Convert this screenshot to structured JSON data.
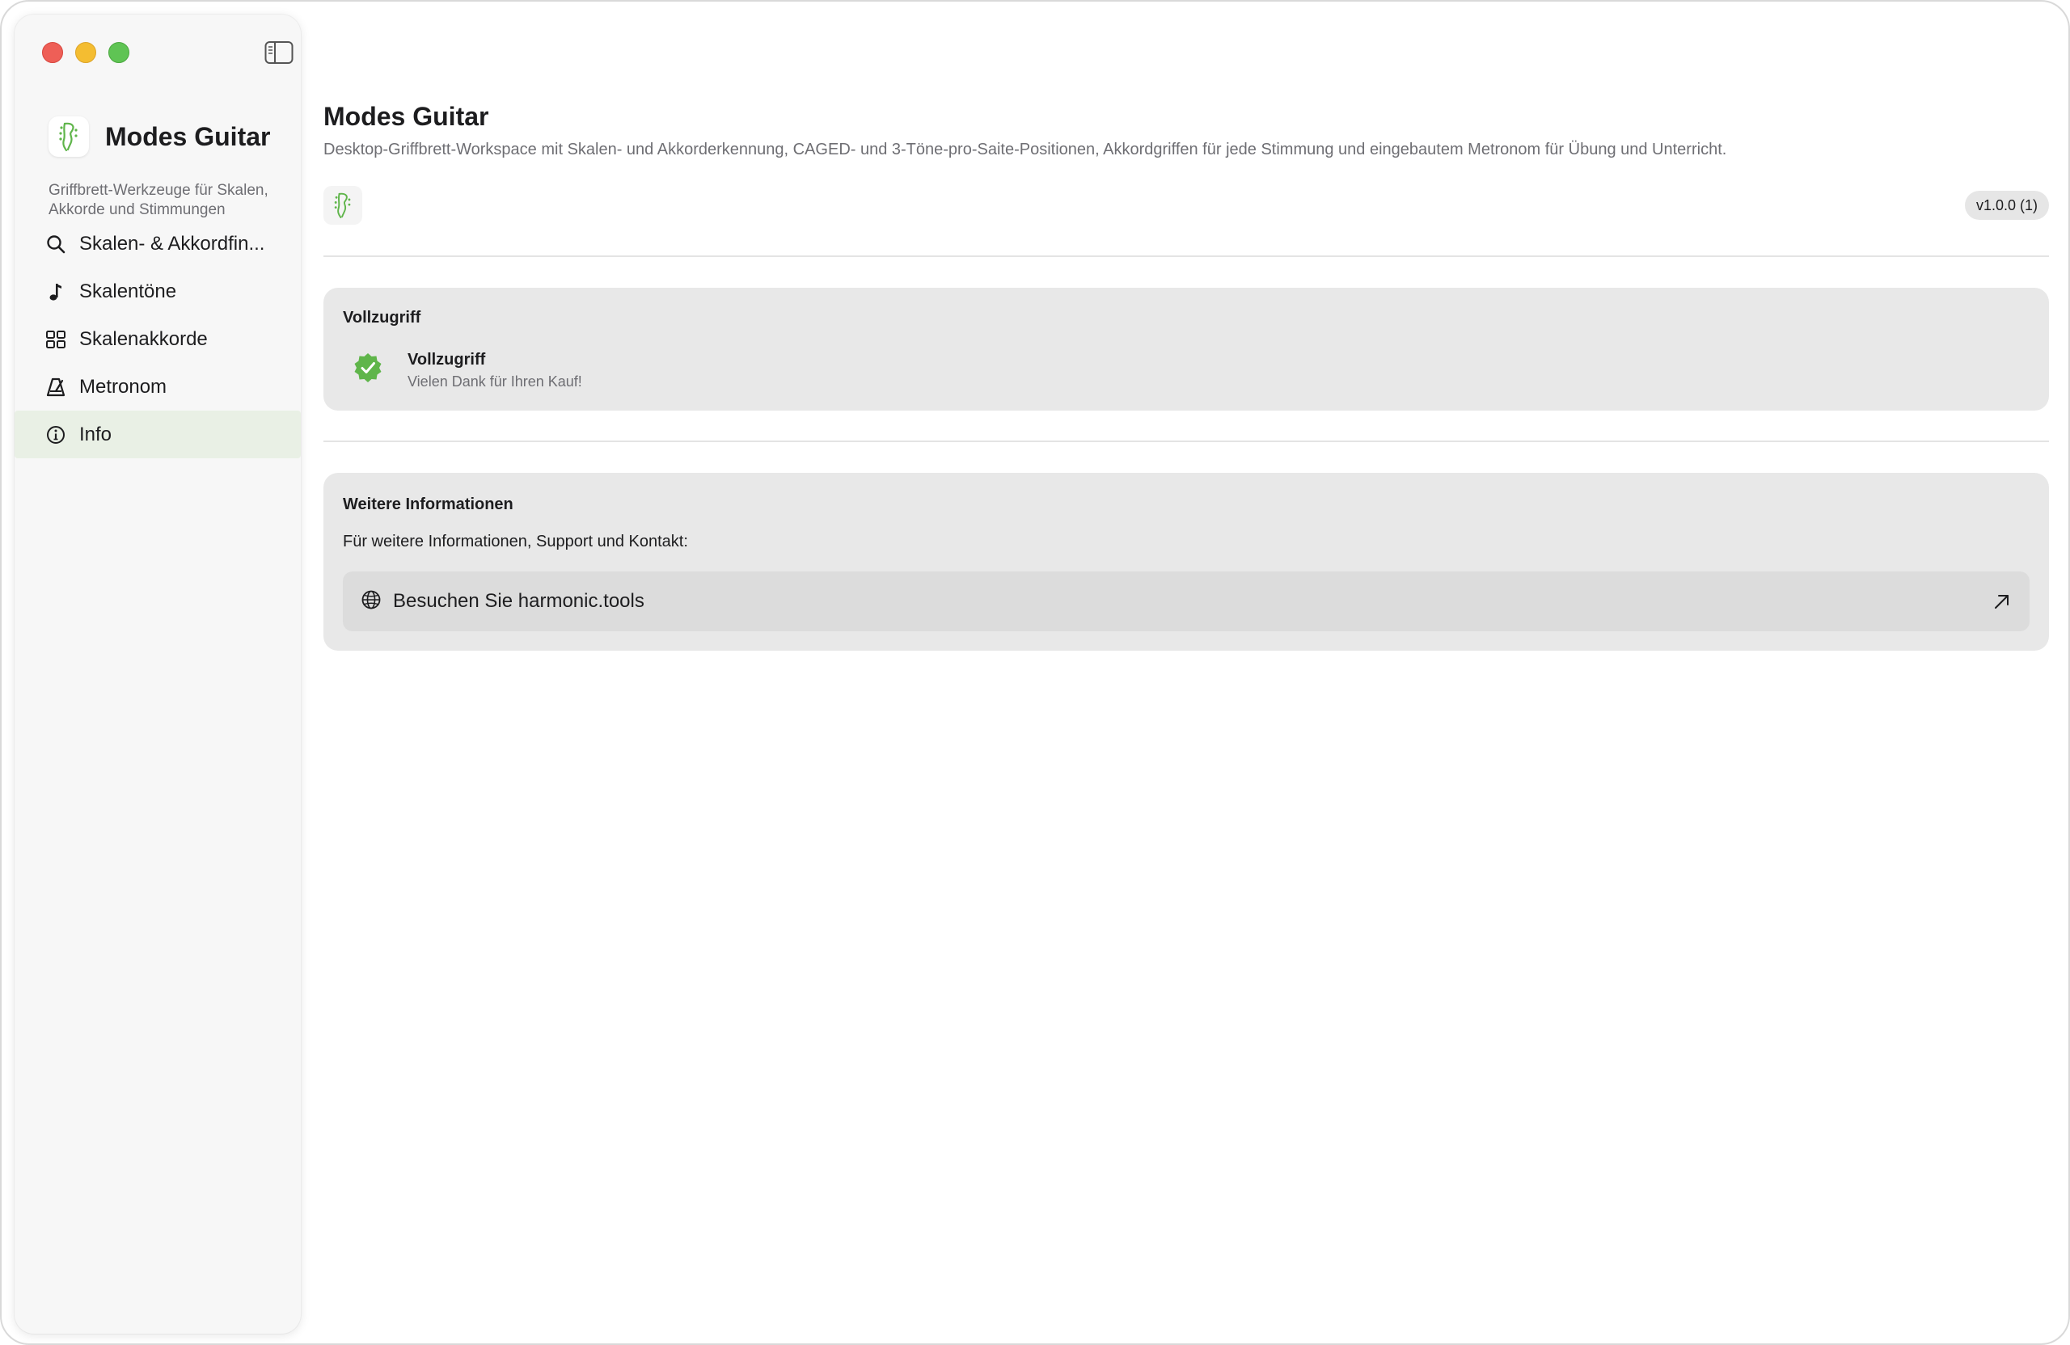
{
  "app": {
    "name": "Modes Guitar",
    "subtitle": "Griffbrett-Werkzeuge für Skalen, Akkorde und Stimmungen"
  },
  "sidebar": {
    "items": [
      {
        "label": "Skalen- & Akkordfin...",
        "icon": "search-icon",
        "active": false
      },
      {
        "label": "Skalentöne",
        "icon": "music-note-icon",
        "active": false
      },
      {
        "label": "Skalenakkorde",
        "icon": "grid-icon",
        "active": false
      },
      {
        "label": "Metronom",
        "icon": "metronome-icon",
        "active": false
      },
      {
        "label": "Info",
        "icon": "info-icon",
        "active": true
      }
    ]
  },
  "main": {
    "title": "Modes Guitar",
    "description": "Desktop-Griffbrett-Workspace mit Skalen- und Akkorderkennung, CAGED- und 3-Töne-pro-Saite-Positionen, Akkordgriffen für jede Stimmung und eingebautem Metronom für Übung und Unterricht.",
    "version": "v1.0.0 (1)"
  },
  "access_card": {
    "title": "Vollzugriff",
    "status_title": "Vollzugriff",
    "status_sub": "Vielen Dank für Ihren Kauf!"
  },
  "info_card": {
    "title": "Weitere Informationen",
    "text": "Für weitere Informationen, Support und Kontakt:",
    "link_label": "Besuchen Sie harmonic.tools"
  },
  "colors": {
    "accent_green": "#5fb54a",
    "active_bg": "#e9f0e5",
    "card_bg": "#e8e8e8"
  }
}
